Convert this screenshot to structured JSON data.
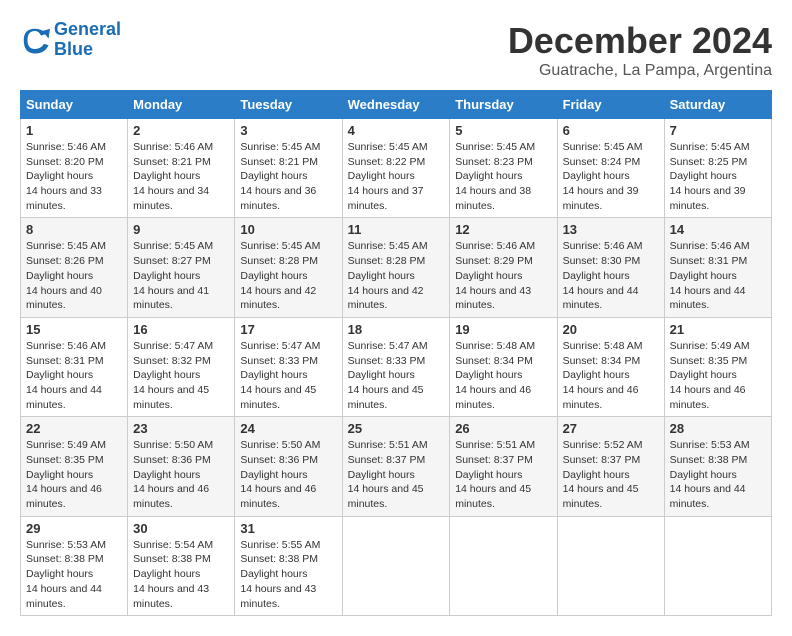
{
  "logo": {
    "line1": "General",
    "line2": "Blue"
  },
  "title": "December 2024",
  "location": "Guatrache, La Pampa, Argentina",
  "days_of_week": [
    "Sunday",
    "Monday",
    "Tuesday",
    "Wednesday",
    "Thursday",
    "Friday",
    "Saturday"
  ],
  "weeks": [
    [
      {
        "day": "1",
        "sunrise": "5:46 AM",
        "sunset": "8:20 PM",
        "daylight": "14 hours and 33 minutes."
      },
      {
        "day": "2",
        "sunrise": "5:46 AM",
        "sunset": "8:21 PM",
        "daylight": "14 hours and 34 minutes."
      },
      {
        "day": "3",
        "sunrise": "5:45 AM",
        "sunset": "8:21 PM",
        "daylight": "14 hours and 36 minutes."
      },
      {
        "day": "4",
        "sunrise": "5:45 AM",
        "sunset": "8:22 PM",
        "daylight": "14 hours and 37 minutes."
      },
      {
        "day": "5",
        "sunrise": "5:45 AM",
        "sunset": "8:23 PM",
        "daylight": "14 hours and 38 minutes."
      },
      {
        "day": "6",
        "sunrise": "5:45 AM",
        "sunset": "8:24 PM",
        "daylight": "14 hours and 39 minutes."
      },
      {
        "day": "7",
        "sunrise": "5:45 AM",
        "sunset": "8:25 PM",
        "daylight": "14 hours and 39 minutes."
      }
    ],
    [
      {
        "day": "8",
        "sunrise": "5:45 AM",
        "sunset": "8:26 PM",
        "daylight": "14 hours and 40 minutes."
      },
      {
        "day": "9",
        "sunrise": "5:45 AM",
        "sunset": "8:27 PM",
        "daylight": "14 hours and 41 minutes."
      },
      {
        "day": "10",
        "sunrise": "5:45 AM",
        "sunset": "8:28 PM",
        "daylight": "14 hours and 42 minutes."
      },
      {
        "day": "11",
        "sunrise": "5:45 AM",
        "sunset": "8:28 PM",
        "daylight": "14 hours and 42 minutes."
      },
      {
        "day": "12",
        "sunrise": "5:46 AM",
        "sunset": "8:29 PM",
        "daylight": "14 hours and 43 minutes."
      },
      {
        "day": "13",
        "sunrise": "5:46 AM",
        "sunset": "8:30 PM",
        "daylight": "14 hours and 44 minutes."
      },
      {
        "day": "14",
        "sunrise": "5:46 AM",
        "sunset": "8:31 PM",
        "daylight": "14 hours and 44 minutes."
      }
    ],
    [
      {
        "day": "15",
        "sunrise": "5:46 AM",
        "sunset": "8:31 PM",
        "daylight": "14 hours and 44 minutes."
      },
      {
        "day": "16",
        "sunrise": "5:47 AM",
        "sunset": "8:32 PM",
        "daylight": "14 hours and 45 minutes."
      },
      {
        "day": "17",
        "sunrise": "5:47 AM",
        "sunset": "8:33 PM",
        "daylight": "14 hours and 45 minutes."
      },
      {
        "day": "18",
        "sunrise": "5:47 AM",
        "sunset": "8:33 PM",
        "daylight": "14 hours and 45 minutes."
      },
      {
        "day": "19",
        "sunrise": "5:48 AM",
        "sunset": "8:34 PM",
        "daylight": "14 hours and 46 minutes."
      },
      {
        "day": "20",
        "sunrise": "5:48 AM",
        "sunset": "8:34 PM",
        "daylight": "14 hours and 46 minutes."
      },
      {
        "day": "21",
        "sunrise": "5:49 AM",
        "sunset": "8:35 PM",
        "daylight": "14 hours and 46 minutes."
      }
    ],
    [
      {
        "day": "22",
        "sunrise": "5:49 AM",
        "sunset": "8:35 PM",
        "daylight": "14 hours and 46 minutes."
      },
      {
        "day": "23",
        "sunrise": "5:50 AM",
        "sunset": "8:36 PM",
        "daylight": "14 hours and 46 minutes."
      },
      {
        "day": "24",
        "sunrise": "5:50 AM",
        "sunset": "8:36 PM",
        "daylight": "14 hours and 46 minutes."
      },
      {
        "day": "25",
        "sunrise": "5:51 AM",
        "sunset": "8:37 PM",
        "daylight": "14 hours and 45 minutes."
      },
      {
        "day": "26",
        "sunrise": "5:51 AM",
        "sunset": "8:37 PM",
        "daylight": "14 hours and 45 minutes."
      },
      {
        "day": "27",
        "sunrise": "5:52 AM",
        "sunset": "8:37 PM",
        "daylight": "14 hours and 45 minutes."
      },
      {
        "day": "28",
        "sunrise": "5:53 AM",
        "sunset": "8:38 PM",
        "daylight": "14 hours and 44 minutes."
      }
    ],
    [
      {
        "day": "29",
        "sunrise": "5:53 AM",
        "sunset": "8:38 PM",
        "daylight": "14 hours and 44 minutes."
      },
      {
        "day": "30",
        "sunrise": "5:54 AM",
        "sunset": "8:38 PM",
        "daylight": "14 hours and 43 minutes."
      },
      {
        "day": "31",
        "sunrise": "5:55 AM",
        "sunset": "8:38 PM",
        "daylight": "14 hours and 43 minutes."
      },
      null,
      null,
      null,
      null
    ]
  ]
}
